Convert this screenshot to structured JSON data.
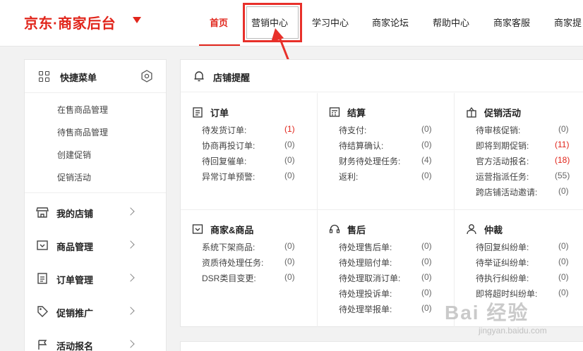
{
  "header": {
    "brand": "京东·商家后台",
    "nav": [
      {
        "label": "首页",
        "active": true
      },
      {
        "label": "营销中心",
        "active": false
      },
      {
        "label": "学习中心",
        "active": false
      },
      {
        "label": "商家论坛",
        "active": false
      },
      {
        "label": "帮助中心",
        "active": false
      },
      {
        "label": "商家客服",
        "active": false
      },
      {
        "label": "商家提",
        "active": false
      }
    ]
  },
  "sidebar": {
    "quick_menu_title": "快捷菜单",
    "quick_links": [
      "在售商品管理",
      "待售商品管理",
      "创建促销",
      "促销活动"
    ],
    "items": [
      {
        "label": "我的店铺",
        "icon": "store-icon"
      },
      {
        "label": "商品管理",
        "icon": "product-icon"
      },
      {
        "label": "订单管理",
        "icon": "order-icon"
      },
      {
        "label": "促销推广",
        "icon": "promotion-icon"
      },
      {
        "label": "活动报名",
        "icon": "activity-icon"
      }
    ]
  },
  "main": {
    "title": "店铺提醒",
    "sections": [
      {
        "title": "订单",
        "rows": [
          {
            "label": "待发货订单:",
            "value": "(1)",
            "red": true
          },
          {
            "label": "协商再投订单:",
            "value": "(0)",
            "red": false
          },
          {
            "label": "待回复催单:",
            "value": "(0)",
            "red": false
          },
          {
            "label": "异常订单预警:",
            "value": "(0)",
            "red": false
          }
        ]
      },
      {
        "title": "结算",
        "rows": [
          {
            "label": "待支付:",
            "value": "(0)",
            "red": false
          },
          {
            "label": "待结算确认:",
            "value": "(0)",
            "red": false
          },
          {
            "label": "财务待处理任务:",
            "value": "(4)",
            "red": false
          },
          {
            "label": "返利:",
            "value": "(0)",
            "red": false
          }
        ]
      },
      {
        "title": "促销活动",
        "rows": [
          {
            "label": "待审核促销:",
            "value": "(0)",
            "red": false
          },
          {
            "label": "即将到期促销:",
            "value": "(11)",
            "red": true
          },
          {
            "label": "官方活动报名:",
            "value": "(18)",
            "red": true
          },
          {
            "label": "运营指派任务:",
            "value": "(55)",
            "red": false
          },
          {
            "label": "跨店铺活动邀请:",
            "value": "(0)",
            "red": false
          }
        ]
      },
      {
        "title": "商家&商品",
        "rows": [
          {
            "label": "系统下架商品:",
            "value": "(0)",
            "red": false
          },
          {
            "label": "资质待处理任务:",
            "value": "(0)",
            "red": false
          },
          {
            "label": "DSR类目变更:",
            "value": "(0)",
            "red": false
          }
        ]
      },
      {
        "title": "售后",
        "rows": [
          {
            "label": "待处理售后单:",
            "value": "(0)",
            "red": false
          },
          {
            "label": "待处理赔付单:",
            "value": "(0)",
            "red": false
          },
          {
            "label": "待处理取消订单:",
            "value": "(0)",
            "red": false
          },
          {
            "label": "待处理投诉单:",
            "value": "(0)",
            "red": false
          },
          {
            "label": "待处理举报单:",
            "value": "(0)",
            "red": false
          }
        ]
      },
      {
        "title": "仲裁",
        "rows": [
          {
            "label": "待回复纠纷单:",
            "value": "(0)",
            "red": false
          },
          {
            "label": "待举证纠纷单:",
            "value": "(0)",
            "red": false
          },
          {
            "label": "待执行纠纷单:",
            "value": "(0)",
            "red": false
          },
          {
            "label": "即将超时纠纷单:",
            "value": "(0)",
            "red": false
          }
        ]
      }
    ]
  },
  "watermark": {
    "text": "Bai 经验",
    "sub": "jingyan.baidu.com"
  },
  "colors": {
    "brand": "#e1251b",
    "highlight": "#e8302a"
  }
}
